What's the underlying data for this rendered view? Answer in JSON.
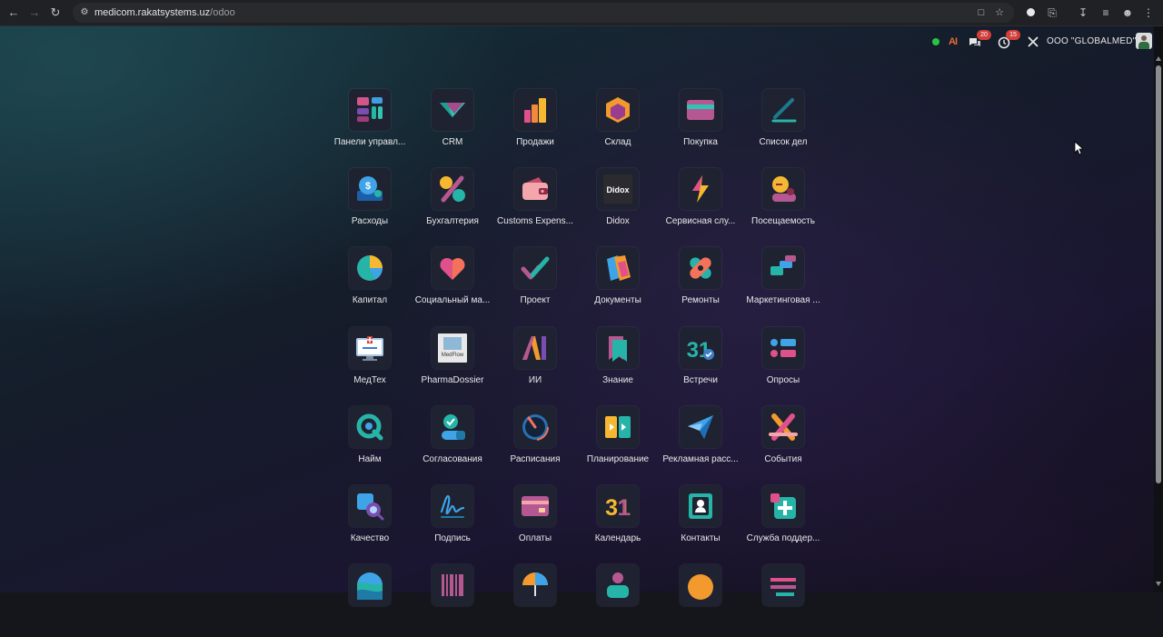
{
  "browser": {
    "url_host": "medicom.rakatsystems.uz",
    "url_path": "/odoo"
  },
  "systray": {
    "messages_count": "20",
    "activities_count": "15",
    "company": "OOO \"GLOBALMED\"",
    "ai_label": "AI"
  },
  "apps": [
    {
      "label": "Панели управл...",
      "icon": "dashboards-icon"
    },
    {
      "label": "CRM",
      "icon": "crm-icon"
    },
    {
      "label": "Продажи",
      "icon": "sales-icon"
    },
    {
      "label": "Склад",
      "icon": "inventory-icon"
    },
    {
      "label": "Покупка",
      "icon": "purchase-icon"
    },
    {
      "label": "Список дел",
      "icon": "todo-icon"
    },
    {
      "label": "Расходы",
      "icon": "expenses-icon"
    },
    {
      "label": "Бухгалтерия",
      "icon": "accounting-icon"
    },
    {
      "label": "Customs Expens...",
      "icon": "customs-expenses-icon"
    },
    {
      "label": "Didox",
      "icon": "didox-icon",
      "icon_text": "Didox"
    },
    {
      "label": "Сервисная слу...",
      "icon": "field-service-icon"
    },
    {
      "label": "Посещаемость",
      "icon": "attendance-icon"
    },
    {
      "label": "Капитал",
      "icon": "equity-icon"
    },
    {
      "label": "Социальный ма...",
      "icon": "social-marketing-icon"
    },
    {
      "label": "Проект",
      "icon": "project-icon"
    },
    {
      "label": "Документы",
      "icon": "documents-icon"
    },
    {
      "label": "Ремонты",
      "icon": "repairs-icon"
    },
    {
      "label": "Маркетинговая ...",
      "icon": "marketing-automation-icon"
    },
    {
      "label": "МедТех",
      "icon": "medtech-icon"
    },
    {
      "label": "PharmaDossier",
      "icon": "pharmadossier-icon",
      "icon_text": "MedFlow"
    },
    {
      "label": "ИИ",
      "icon": "ai-icon"
    },
    {
      "label": "Знание",
      "icon": "knowledge-icon"
    },
    {
      "label": "Встречи",
      "icon": "appointments-icon",
      "icon_text": "31"
    },
    {
      "label": "Опросы",
      "icon": "surveys-icon"
    },
    {
      "label": "Найм",
      "icon": "recruitment-icon"
    },
    {
      "label": "Согласования",
      "icon": "approvals-icon"
    },
    {
      "label": "Расписания",
      "icon": "timesheets-icon"
    },
    {
      "label": "Планирование",
      "icon": "planning-icon"
    },
    {
      "label": "Рекламная расс...",
      "icon": "email-marketing-icon"
    },
    {
      "label": "События",
      "icon": "events-icon"
    },
    {
      "label": "Качество",
      "icon": "quality-icon"
    },
    {
      "label": "Подпись",
      "icon": "sign-icon"
    },
    {
      "label": "Оплаты",
      "icon": "payments-icon"
    },
    {
      "label": "Календарь",
      "icon": "calendar-icon",
      "icon_text": "31"
    },
    {
      "label": "Контакты",
      "icon": "contacts-icon"
    },
    {
      "label": "Служба поддер...",
      "icon": "helpdesk-icon"
    },
    {
      "label": "",
      "icon": "website-icon"
    },
    {
      "label": "",
      "icon": "barcode-icon"
    },
    {
      "label": "",
      "icon": "insurance-icon"
    },
    {
      "label": "",
      "icon": "employees-icon"
    },
    {
      "label": "",
      "icon": "live-chat-icon"
    },
    {
      "label": "",
      "icon": "data-cleaning-icon"
    }
  ]
}
